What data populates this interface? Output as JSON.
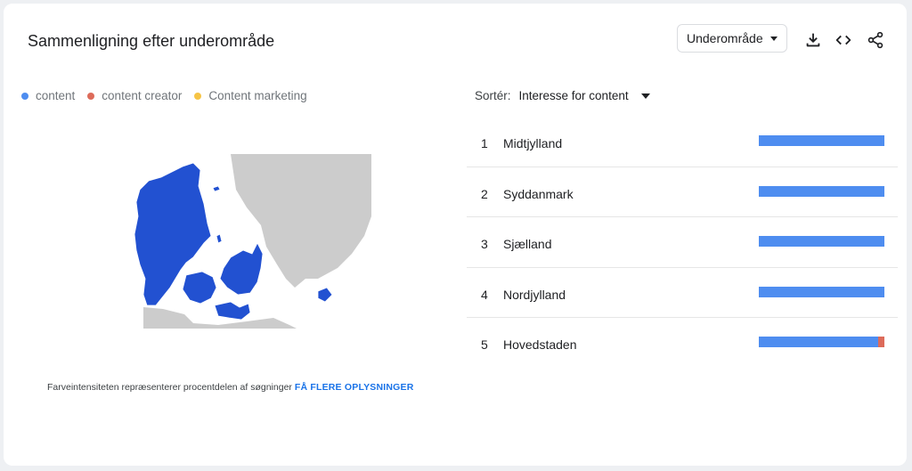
{
  "header": {
    "title": "Sammenligning efter underområde",
    "dropdown_label": "Underområde"
  },
  "icons": {
    "download": "download-icon",
    "embed": "code-icon",
    "share": "share-icon"
  },
  "legend": [
    {
      "label": "content",
      "color": "#4e8df0"
    },
    {
      "label": "content creator",
      "color": "#dd6b5a"
    },
    {
      "label": "Content marketing",
      "color": "#f6c445"
    }
  ],
  "map": {
    "fill_color": "#2251d1",
    "neighbor_color": "#cccccc"
  },
  "footnote": {
    "text": "Farveintensiteten repræsenterer procentdelen af søgninger",
    "link": "FÅ FLERE OPLYSNINGER"
  },
  "sort": {
    "label": "Sortér:",
    "value": "Interesse for content"
  },
  "regions": [
    {
      "rank": "1",
      "name": "Midtjylland",
      "content_share": 1.0,
      "creator_share": 0.0
    },
    {
      "rank": "2",
      "name": "Syddanmark",
      "content_share": 1.0,
      "creator_share": 0.0
    },
    {
      "rank": "3",
      "name": "Sjælland",
      "content_share": 1.0,
      "creator_share": 0.0
    },
    {
      "rank": "4",
      "name": "Nordjylland",
      "content_share": 1.0,
      "creator_share": 0.0
    },
    {
      "rank": "5",
      "name": "Hovedstaden",
      "content_share": 0.95,
      "creator_share": 0.05
    }
  ]
}
